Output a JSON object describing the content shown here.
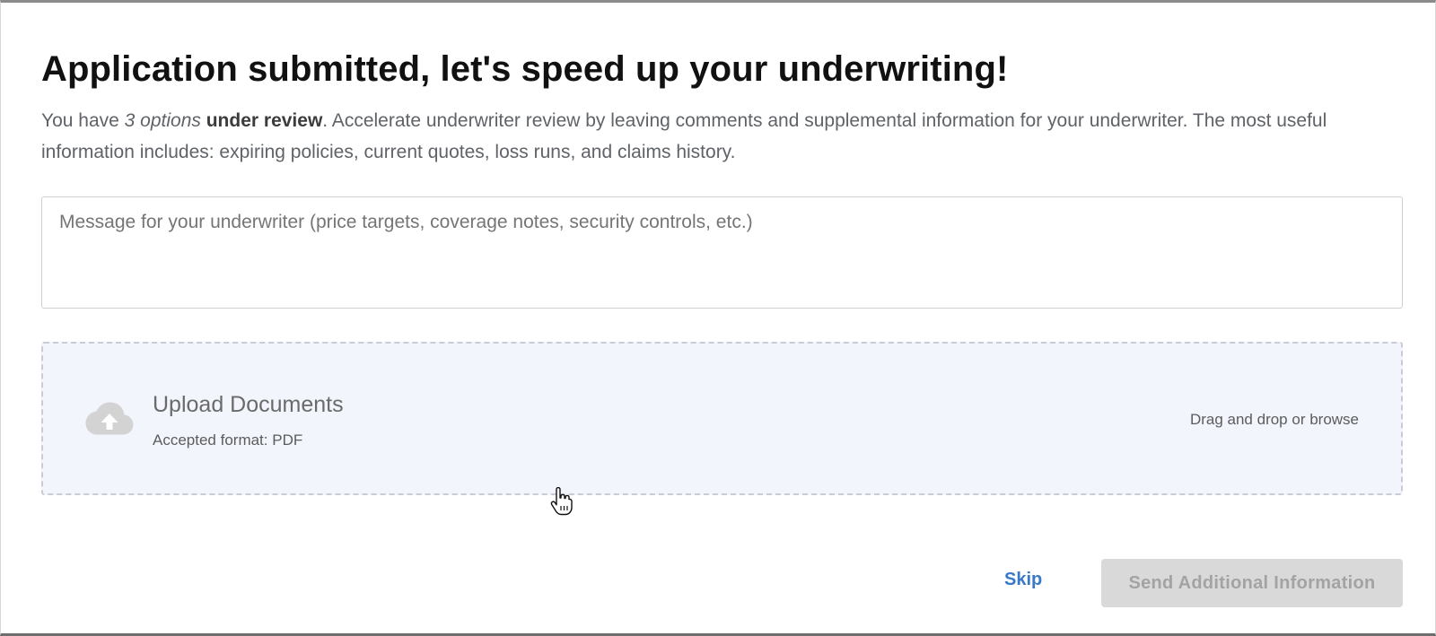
{
  "modal": {
    "title": "Application submitted, let's speed up your underwriting!",
    "intro": {
      "prefix": "You have ",
      "options_count": "3 options",
      "status": "under review",
      "rest": ". Accelerate underwriter review by leaving comments and supplemental information for your underwriter. The most useful information includes: expiring policies, current quotes, loss runs, and claims history."
    }
  },
  "message": {
    "placeholder": "Message for your underwriter (price targets, coverage notes, security controls, etc.)",
    "value": ""
  },
  "upload": {
    "icon": "cloud-upload-icon",
    "title": "Upload Documents",
    "accepted_format": "Accepted format: PDF",
    "browse_hint": "Drag and drop or browse"
  },
  "actions": {
    "skip_label": "Skip",
    "send_label": "Send Additional Information",
    "send_enabled": false
  },
  "colors": {
    "link": "#3a78c9",
    "upload_bg": "#f2f5fc",
    "disabled_button_bg": "#d9d9d9",
    "disabled_button_text": "#a3a3a3"
  },
  "pointer": {
    "icon": "hand-pointer-icon"
  }
}
